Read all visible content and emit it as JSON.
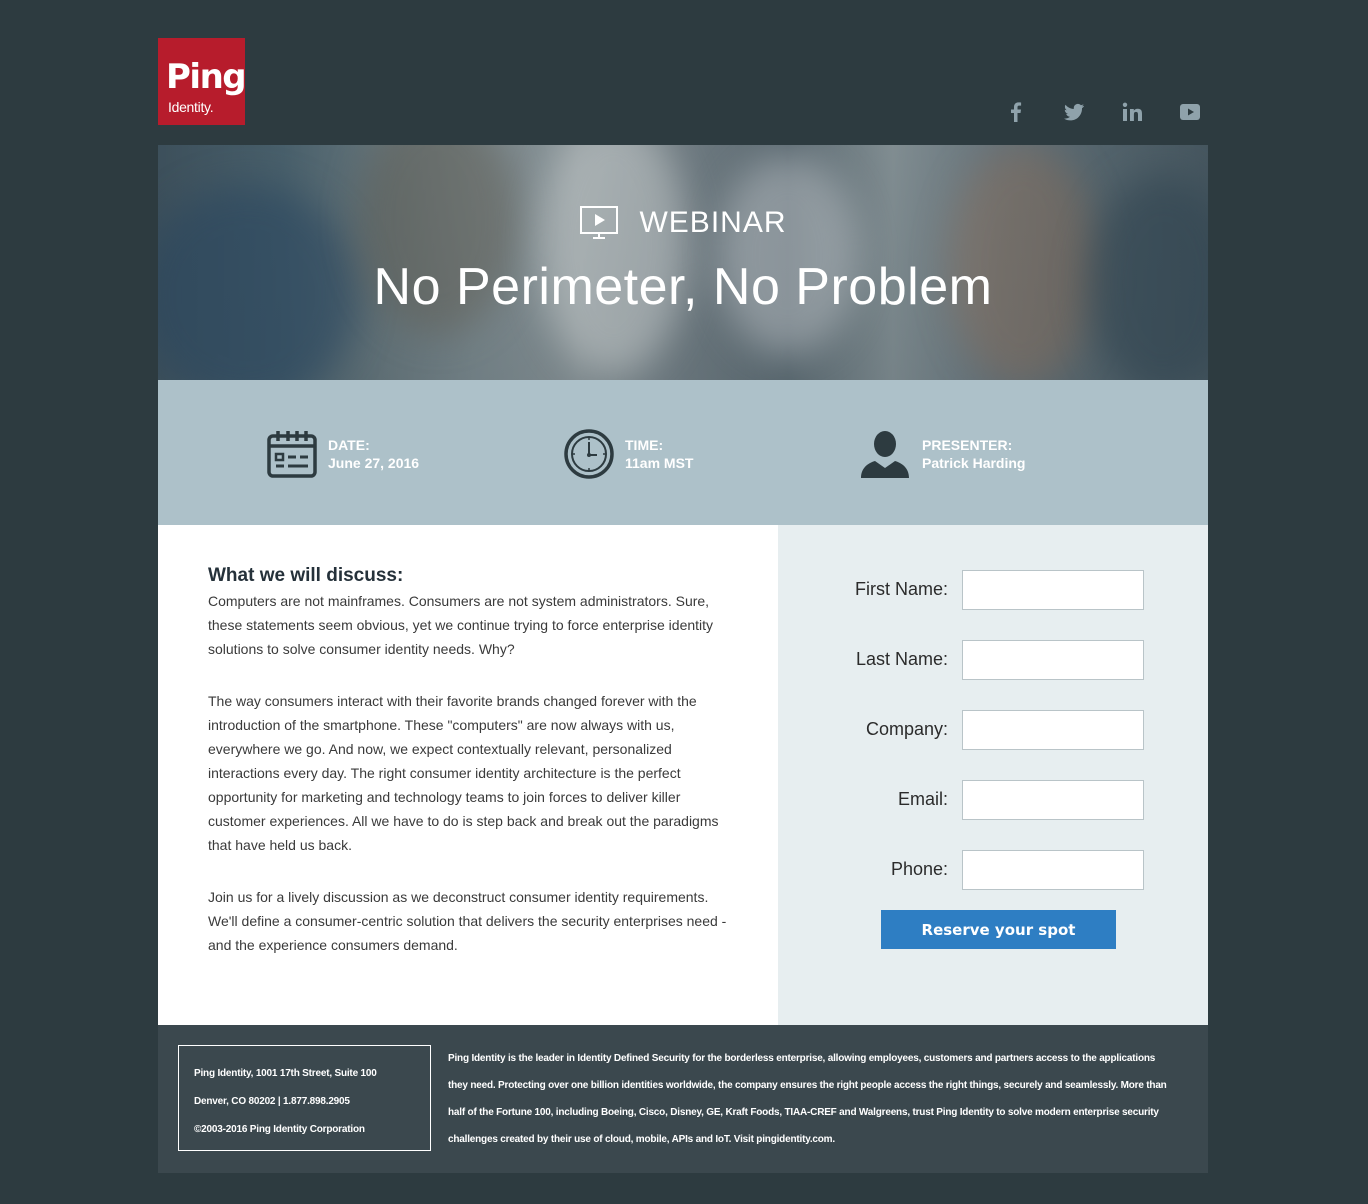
{
  "brand": {
    "logo_main": "Ping",
    "logo_sub": "Identity."
  },
  "social": [
    "facebook-icon",
    "twitter-icon",
    "linkedin-icon",
    "youtube-icon"
  ],
  "hero": {
    "label": "WEBINAR",
    "title": "No Perimeter, No Problem"
  },
  "info": {
    "date_label": "DATE:",
    "date_value": "June 27, 2016",
    "time_label": "TIME:",
    "time_value": "11am MST",
    "presenter_label": "PRESENTER:",
    "presenter_value": "Patrick Harding"
  },
  "content": {
    "heading": "What we will discuss:",
    "paragraphs": [
      "Computers are not mainframes. Consumers are not system administrators. Sure, these statements seem obvious, yet we continue trying to force enterprise identity solutions to solve consumer identity needs. Why?",
      "The way consumers interact with their favorite brands changed forever with the introduction of the smartphone. These \"computers\" are now always with us, everywhere we go. And now, we expect contextually relevant, personalized interactions every day. The right consumer identity architecture is the perfect opportunity for marketing and technology teams to join forces to deliver killer customer experiences. All we have to do is step back and break out the paradigms that have held us back.",
      "Join us for a lively discussion as we deconstruct consumer identity requirements. We'll define a consumer-centric solution that delivers the security enterprises need - and the experience consumers demand."
    ]
  },
  "form": {
    "fields": [
      {
        "label": "First Name:",
        "value": ""
      },
      {
        "label": "Last Name:",
        "value": ""
      },
      {
        "label": "Company:",
        "value": ""
      },
      {
        "label": "Email:",
        "value": ""
      },
      {
        "label": "Phone:",
        "value": ""
      }
    ],
    "submit_label": "Reserve your spot"
  },
  "footer": {
    "address_line1": "Ping Identity, 1001 17th Street, Suite 100",
    "address_line2": "Denver, CO 80202 | 1.877.898.2905",
    "copyright": "©2003-2016 Ping Identity Corporation",
    "about": "Ping Identity is the leader in Identity Defined Security for the borderless enterprise, allowing employees, customers and partners access to the applications they need. Protecting over one billion identities worldwide, the company ensures the right people access the right things, securely and seamlessly. More than half of the Fortune 100, including Boeing, Cisco, Disney, GE, Kraft Foods, TIAA-CREF and Walgreens, trust Ping Identity to solve modern enterprise security challenges created by their use of cloud, mobile, APIs and IoT. Visit pingidentity.com."
  },
  "colors": {
    "page_bg": "#2d3b40",
    "logo_red": "#b71c2c",
    "info_band": "#adc1c9",
    "form_bg": "#e7eef0",
    "button_blue": "#2e7ec3",
    "footer_bg": "#3b484e",
    "social_icon": "#8fa2ab"
  }
}
